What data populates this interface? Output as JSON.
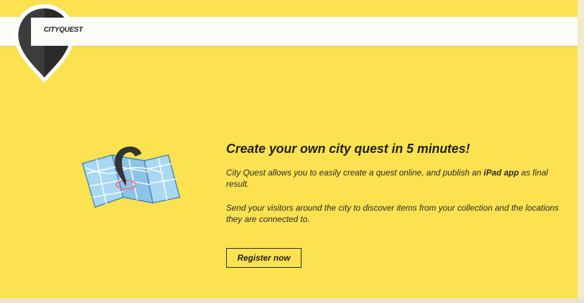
{
  "brand": {
    "name": "CITYQUEST"
  },
  "hero": {
    "title": "Create your own city quest in 5 minutes!",
    "intro_before": "City Quest allows you to easily create a quest online, and publish an ",
    "intro_bold": "iPad app",
    "intro_after": " as final result.",
    "description": "Send your visitors around the city to discover items from your collection and the locations they are connected to.",
    "register_label": "Register now"
  },
  "colors": {
    "background": "#fce150",
    "header": "#fbfbf8",
    "text": "#1f1f1f",
    "pin": "#3a3a3a",
    "map": "#9fd0ec"
  },
  "icons": [
    "map-pin-logo-icon",
    "city-map-icon"
  ]
}
